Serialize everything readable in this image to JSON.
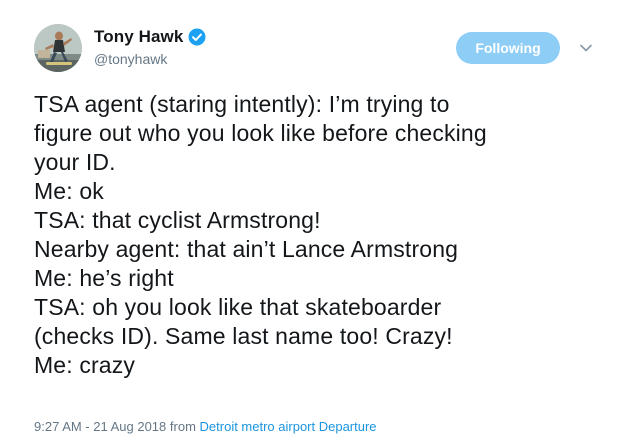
{
  "user": {
    "display_name": "Tony Hawk",
    "handle": "@tonyhawk",
    "verified": true
  },
  "follow_button_label": "Following",
  "tweet": {
    "lines": [
      "TSA agent (staring intently): I’m trying to",
      "figure out who you look like before checking",
      "your ID.",
      "Me: ok",
      "TSA: that cyclist Armstrong!",
      "Nearby agent: that ain’t Lance Armstrong",
      "Me: he’s right",
      "TSA: oh you look like that skateboarder",
      "(checks ID). Same last name too! Crazy!",
      "Me: crazy"
    ]
  },
  "meta": {
    "timestamp": "9:27 AM - 21 Aug 2018",
    "from_label": "from",
    "source": "Detroit metro airport Departure"
  },
  "colors": {
    "follow_button_bg": "#8ecdf6",
    "link": "#1b95e0",
    "verified_badge": "#1da1f2",
    "secondary_text": "#657786"
  },
  "icons": {
    "verified": "verified-badge-icon",
    "more": "chevron-down-icon"
  }
}
